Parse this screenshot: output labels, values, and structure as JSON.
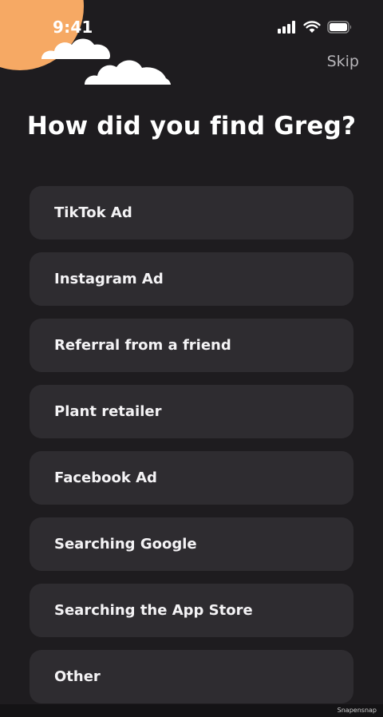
{
  "status_bar": {
    "time": "9:41",
    "icons": [
      "signal-icon",
      "wifi-icon",
      "battery-icon"
    ]
  },
  "header": {
    "skip_label": "Skip"
  },
  "title": "How did you find Greg?",
  "options": [
    {
      "label": "TikTok Ad"
    },
    {
      "label": "Instagram Ad"
    },
    {
      "label": "Referral from a friend"
    },
    {
      "label": "Plant retailer"
    },
    {
      "label": "Facebook Ad"
    },
    {
      "label": "Searching Google"
    },
    {
      "label": "Searching the App Store"
    },
    {
      "label": "Other"
    }
  ],
  "watermark": "Snapensnap",
  "colors": {
    "background": "#1e1c1f",
    "option_background": "#2e2c30",
    "sun": "#f6a964",
    "skip_text": "#b7b5b9"
  }
}
